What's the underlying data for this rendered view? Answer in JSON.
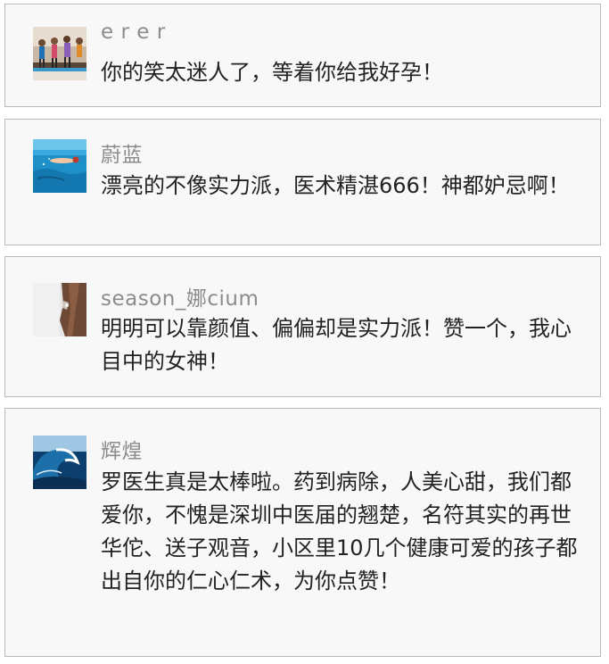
{
  "comments": [
    {
      "username": "e r e r",
      "text": "你的笑太迷人了，等着你给我好孕！",
      "avatar_icon": "aerobics-class-photo-icon"
    },
    {
      "username": "蔚蓝",
      "text": "漂亮的不像实力派，医术精湛666！神都妒忌啊！",
      "avatar_icon": "underwater-swimmer-photo-icon"
    },
    {
      "username": "season_娜cium",
      "text": "明明可以靠颜值、偏偏却是实力派！赞一个，我心目中的女神！",
      "avatar_icon": "rock-cliff-photo-icon"
    },
    {
      "username": "辉煌",
      "text": "罗医生真是太棒啦。药到病除，人美心甜，我们都爱你，不愧是深圳中医届的翘楚，名符其实的再世华佗、送子观音，小区里10几个健康可爱的孩子都出自你的仁心仁术，为你点赞！",
      "avatar_icon": "ocean-wave-photo-icon"
    }
  ]
}
